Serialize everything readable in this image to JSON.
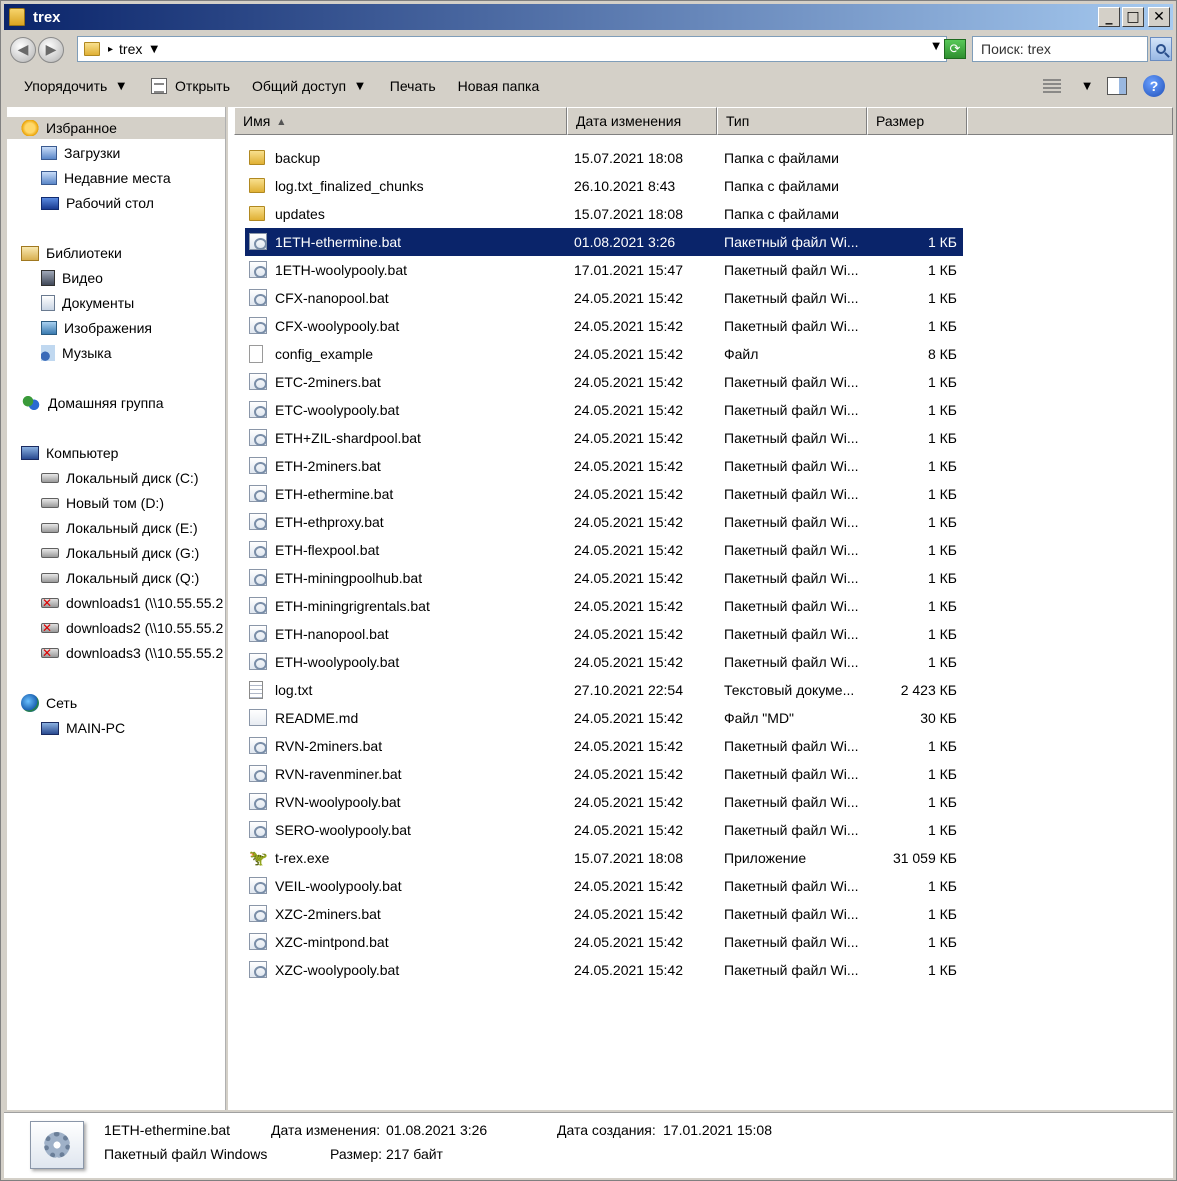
{
  "window": {
    "title": "trex",
    "minimize": "_",
    "maximize": "□",
    "close": "✕"
  },
  "address": {
    "path": "trex",
    "arrow": "▸",
    "dropdown": "▼"
  },
  "search": {
    "placeholder": "Поиск: trex"
  },
  "toolbar": {
    "organize": "Упорядочить",
    "open": "Открыть",
    "share": "Общий доступ",
    "print": "Печать",
    "new_folder": "Новая папка",
    "dropdown_arrow": "▼",
    "help": "?"
  },
  "sidebar": {
    "favorites": {
      "label": "Избранное",
      "items": [
        "Загрузки",
        "Недавние места",
        "Рабочий стол"
      ]
    },
    "libraries": {
      "label": "Библиотеки",
      "items": [
        "Видео",
        "Документы",
        "Изображения",
        "Музыка"
      ]
    },
    "homegroup": {
      "label": "Домашняя группа"
    },
    "computer": {
      "label": "Компьютер",
      "items": [
        "Локальный диск (C:)",
        "Новый том (D:)",
        "Локальный диск (E:)",
        "Локальный диск (G:)",
        "Локальный диск (Q:)",
        "downloads1 (\\\\10.55.55.2",
        "downloads2 (\\\\10.55.55.2",
        "downloads3 (\\\\10.55.55.2"
      ]
    },
    "network": {
      "label": "Сеть",
      "items": [
        "MAIN-PC"
      ]
    }
  },
  "columns": {
    "name": "Имя",
    "date": "Дата изменения",
    "type": "Тип",
    "size": "Размер",
    "sort_arrow": "▲"
  },
  "files": [
    {
      "name": "backup",
      "date": "15.07.2021 18:08",
      "type": "Папка с файлами",
      "size": "",
      "icon": "folder"
    },
    {
      "name": "log.txt_finalized_chunks",
      "date": "26.10.2021 8:43",
      "type": "Папка с файлами",
      "size": "",
      "icon": "folder"
    },
    {
      "name": "updates",
      "date": "15.07.2021 18:08",
      "type": "Папка с файлами",
      "size": "",
      "icon": "folder"
    },
    {
      "name": "1ETH-ethermine.bat",
      "date": "01.08.2021 3:26",
      "type": "Пакетный файл Wi...",
      "size": "1 КБ",
      "icon": "bat",
      "selected": true
    },
    {
      "name": "1ETH-woolypooly.bat",
      "date": "17.01.2021 15:47",
      "type": "Пакетный файл Wi...",
      "size": "1 КБ",
      "icon": "bat"
    },
    {
      "name": "CFX-nanopool.bat",
      "date": "24.05.2021 15:42",
      "type": "Пакетный файл Wi...",
      "size": "1 КБ",
      "icon": "bat"
    },
    {
      "name": "CFX-woolypooly.bat",
      "date": "24.05.2021 15:42",
      "type": "Пакетный файл Wi...",
      "size": "1 КБ",
      "icon": "bat"
    },
    {
      "name": "config_example",
      "date": "24.05.2021 15:42",
      "type": "Файл",
      "size": "8 КБ",
      "icon": "file"
    },
    {
      "name": "ETC-2miners.bat",
      "date": "24.05.2021 15:42",
      "type": "Пакетный файл Wi...",
      "size": "1 КБ",
      "icon": "bat"
    },
    {
      "name": "ETC-woolypooly.bat",
      "date": "24.05.2021 15:42",
      "type": "Пакетный файл Wi...",
      "size": "1 КБ",
      "icon": "bat"
    },
    {
      "name": "ETH+ZIL-shardpool.bat",
      "date": "24.05.2021 15:42",
      "type": "Пакетный файл Wi...",
      "size": "1 КБ",
      "icon": "bat"
    },
    {
      "name": "ETH-2miners.bat",
      "date": "24.05.2021 15:42",
      "type": "Пакетный файл Wi...",
      "size": "1 КБ",
      "icon": "bat"
    },
    {
      "name": "ETH-ethermine.bat",
      "date": "24.05.2021 15:42",
      "type": "Пакетный файл Wi...",
      "size": "1 КБ",
      "icon": "bat"
    },
    {
      "name": "ETH-ethproxy.bat",
      "date": "24.05.2021 15:42",
      "type": "Пакетный файл Wi...",
      "size": "1 КБ",
      "icon": "bat"
    },
    {
      "name": "ETH-flexpool.bat",
      "date": "24.05.2021 15:42",
      "type": "Пакетный файл Wi...",
      "size": "1 КБ",
      "icon": "bat"
    },
    {
      "name": "ETH-miningpoolhub.bat",
      "date": "24.05.2021 15:42",
      "type": "Пакетный файл Wi...",
      "size": "1 КБ",
      "icon": "bat"
    },
    {
      "name": "ETH-miningrigrentals.bat",
      "date": "24.05.2021 15:42",
      "type": "Пакетный файл Wi...",
      "size": "1 КБ",
      "icon": "bat"
    },
    {
      "name": "ETH-nanopool.bat",
      "date": "24.05.2021 15:42",
      "type": "Пакетный файл Wi...",
      "size": "1 КБ",
      "icon": "bat"
    },
    {
      "name": "ETH-woolypooly.bat",
      "date": "24.05.2021 15:42",
      "type": "Пакетный файл Wi...",
      "size": "1 КБ",
      "icon": "bat"
    },
    {
      "name": "log.txt",
      "date": "27.10.2021 22:54",
      "type": "Текстовый докуме...",
      "size": "2 423 КБ",
      "icon": "txt"
    },
    {
      "name": "README.md",
      "date": "24.05.2021 15:42",
      "type": "Файл \"MD\"",
      "size": "30 КБ",
      "icon": "md"
    },
    {
      "name": "RVN-2miners.bat",
      "date": "24.05.2021 15:42",
      "type": "Пакетный файл Wi...",
      "size": "1 КБ",
      "icon": "bat"
    },
    {
      "name": "RVN-ravenminer.bat",
      "date": "24.05.2021 15:42",
      "type": "Пакетный файл Wi...",
      "size": "1 КБ",
      "icon": "bat"
    },
    {
      "name": "RVN-woolypooly.bat",
      "date": "24.05.2021 15:42",
      "type": "Пакетный файл Wi...",
      "size": "1 КБ",
      "icon": "bat"
    },
    {
      "name": "SERO-woolypooly.bat",
      "date": "24.05.2021 15:42",
      "type": "Пакетный файл Wi...",
      "size": "1 КБ",
      "icon": "bat"
    },
    {
      "name": "t-rex.exe",
      "date": "15.07.2021 18:08",
      "type": "Приложение",
      "size": "31 059 КБ",
      "icon": "exe"
    },
    {
      "name": "VEIL-woolypooly.bat",
      "date": "24.05.2021 15:42",
      "type": "Пакетный файл Wi...",
      "size": "1 КБ",
      "icon": "bat"
    },
    {
      "name": "XZC-2miners.bat",
      "date": "24.05.2021 15:42",
      "type": "Пакетный файл Wi...",
      "size": "1 КБ",
      "icon": "bat"
    },
    {
      "name": "XZC-mintpond.bat",
      "date": "24.05.2021 15:42",
      "type": "Пакетный файл Wi...",
      "size": "1 КБ",
      "icon": "bat"
    },
    {
      "name": "XZC-woolypooly.bat",
      "date": "24.05.2021 15:42",
      "type": "Пакетный файл Wi...",
      "size": "1 КБ",
      "icon": "bat"
    }
  ],
  "details": {
    "name": "1ETH-ethermine.bat",
    "type": "Пакетный файл Windows",
    "modified_label": "Дата изменения:",
    "modified_value": "01.08.2021 3:26",
    "size_label": "Размер:",
    "size_value": "217 байт",
    "created_label": "Дата создания:",
    "created_value": "17.01.2021 15:08"
  },
  "colors": {
    "selection": "#0a246a",
    "titlebar_start": "#0a246a",
    "titlebar_end": "#a6caf0",
    "chrome": "#d4d0c8"
  }
}
